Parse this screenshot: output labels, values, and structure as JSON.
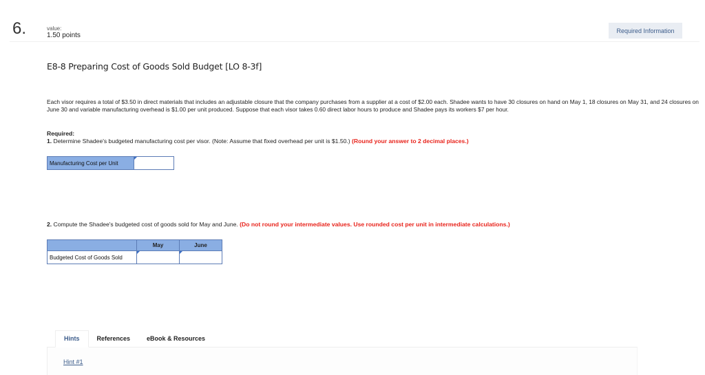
{
  "question": {
    "number": "6.",
    "value_label": "value:",
    "points": "1.50 points",
    "required_info_button": "Required Information"
  },
  "title": "E8-8 Preparing Cost of Goods Sold Budget [LO 8-3f]",
  "paragraph": "Each visor requires a total of $3.50 in direct materials that includes an adjustable closure that the company purchases from a supplier at a cost of $2.00 each. Shadee wants to have 30 closures on hand on May 1, 18 closures on May 31, and 24 closures on June 30 and variable manufacturing overhead is $1.00 per unit produced. Suppose that each visor takes 0.60 direct labor hours to produce and Shadee pays its workers $7 per hour.",
  "required": {
    "heading": "Required:",
    "part1": {
      "number": "1.",
      "text": " Determine Shadee's budgeted manufacturing cost per visor. (Note: Assume that fixed overhead per unit is $1.50.) ",
      "instruction": "(Round your answer to 2 decimal places.)",
      "table": {
        "label": "Manufacturing Cost per Unit",
        "value": ""
      }
    },
    "part2": {
      "number": "2.",
      "text": " Compute the Shadee's budgeted cost of goods sold for May and June. ",
      "instruction": "(Do not round your intermediate values. Use rounded cost per unit in intermediate calculations.)",
      "table": {
        "headers": [
          "",
          "May",
          "June"
        ],
        "row_label": "Budgeted Cost of Goods Sold",
        "values": [
          "",
          ""
        ]
      }
    }
  },
  "tabs": [
    {
      "label": "Hints",
      "active": true
    },
    {
      "label": "References",
      "active": false
    },
    {
      "label": "eBook & Resources",
      "active": false
    }
  ],
  "hint_link": "Hint #1",
  "colors": {
    "accent_blue": "#3b5b8a",
    "table_header": "#8aaee3",
    "table_border": "#5b7bb5",
    "instruction_red": "#e8231b"
  }
}
